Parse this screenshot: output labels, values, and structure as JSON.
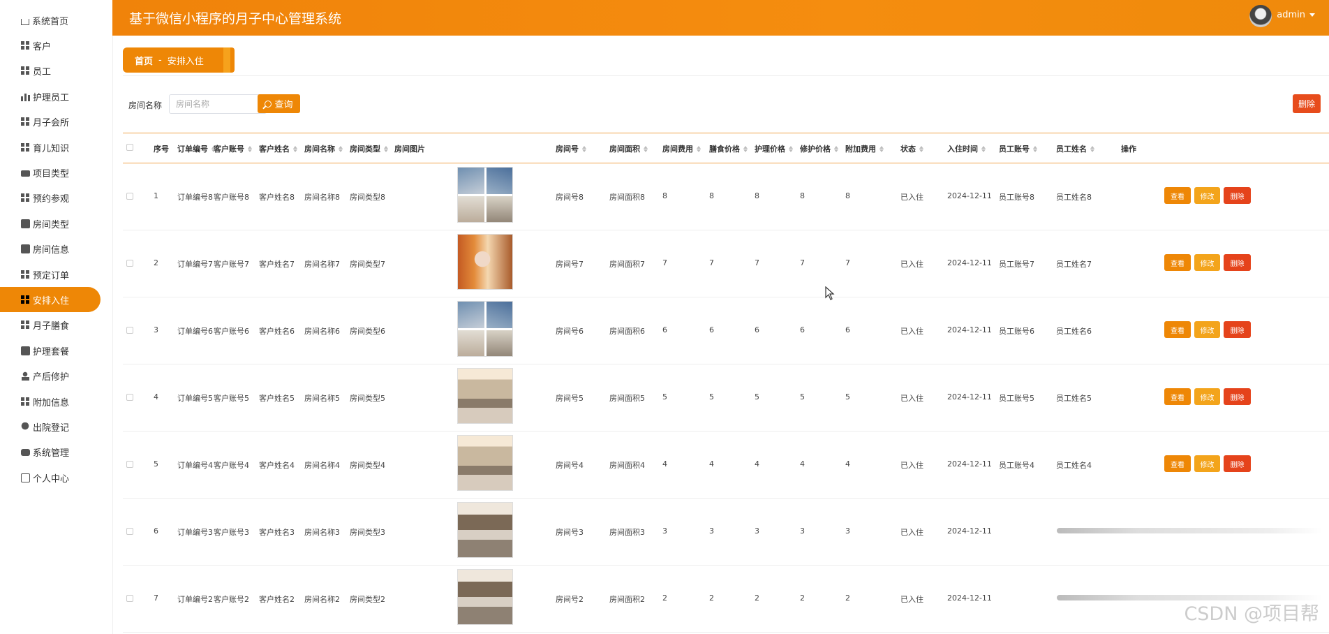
{
  "app": {
    "title": "基于微信小程序的月子中心管理系统",
    "user": "admin"
  },
  "sidebar": {
    "items": [
      {
        "label": "系统首页",
        "icon": "home-icon"
      },
      {
        "label": "客户",
        "icon": "grid-icon"
      },
      {
        "label": "员工",
        "icon": "grid-icon"
      },
      {
        "label": "护理员工",
        "icon": "bar-chart-icon"
      },
      {
        "label": "月子会所",
        "icon": "grid-icon"
      },
      {
        "label": "育儿知识",
        "icon": "grid-icon"
      },
      {
        "label": "项目类型",
        "icon": "message-icon"
      },
      {
        "label": "预约参观",
        "icon": "grid-icon"
      },
      {
        "label": "房间类型",
        "icon": "clipboard-icon"
      },
      {
        "label": "房间信息",
        "icon": "clipboard-icon"
      },
      {
        "label": "预定订单",
        "icon": "grid-icon"
      },
      {
        "label": "安排入住",
        "icon": "grid-icon",
        "active": true
      },
      {
        "label": "月子膳食",
        "icon": "grid-icon"
      },
      {
        "label": "护理套餐",
        "icon": "picture-icon"
      },
      {
        "label": "产后修护",
        "icon": "user-icon"
      },
      {
        "label": "附加信息",
        "icon": "grid-icon"
      },
      {
        "label": "出院登记",
        "icon": "location-icon"
      },
      {
        "label": "系统管理",
        "icon": "database-icon"
      },
      {
        "label": "个人中心",
        "icon": "box-icon"
      }
    ]
  },
  "breadcrumb": {
    "home": "首页",
    "separator": "-",
    "current": "安排入住"
  },
  "search": {
    "label": "房间名称",
    "placeholder": "房间名称",
    "query_button": "查询",
    "delete_button": "删除"
  },
  "table": {
    "columns": [
      "序号",
      "订单编号",
      "客户账号",
      "客户姓名",
      "房间名称",
      "房间类型",
      "房间图片",
      "房间号",
      "房间面积",
      "房间费用",
      "膳食价格",
      "护理价格",
      "修护价格",
      "附加费用",
      "状态",
      "入住时间",
      "员工账号",
      "员工姓名",
      "操作"
    ],
    "actions": {
      "view": "查看",
      "edit": "修改",
      "delete": "删除"
    },
    "rows": [
      {
        "no": "1",
        "order": "订单编号8",
        "account": "客户账号8",
        "name": "客户姓名8",
        "room_name": "房间名称8",
        "room_type": "房间类型8",
        "room_no": "房间号8",
        "area": "房间面积8",
        "room_fee": "8",
        "meal": "8",
        "care": "8",
        "repair": "8",
        "extra": "8",
        "status": "已入住",
        "checkin": "2024-12-11",
        "staff_account": "员工账号8",
        "staff_name": "员工姓名8",
        "image": "photo-collage-icon"
      },
      {
        "no": "2",
        "order": "订单编号7",
        "account": "客户账号7",
        "name": "客户姓名7",
        "room_name": "房间名称7",
        "room_type": "房间类型7",
        "room_no": "房间号7",
        "area": "房间面积7",
        "room_fee": "7",
        "meal": "7",
        "care": "7",
        "repair": "7",
        "extra": "7",
        "status": "已入住",
        "checkin": "2024-12-11",
        "staff_account": "员工账号7",
        "staff_name": "员工姓名7",
        "image": "mother-baby-photo-icon"
      },
      {
        "no": "3",
        "order": "订单编号6",
        "account": "客户账号6",
        "name": "客户姓名6",
        "room_name": "房间名称6",
        "room_type": "房间类型6",
        "room_no": "房间号6",
        "area": "房间面积6",
        "room_fee": "6",
        "meal": "6",
        "care": "6",
        "repair": "6",
        "extra": "6",
        "status": "已入住",
        "checkin": "2024-12-11",
        "staff_account": "员工账号6",
        "staff_name": "员工姓名6",
        "image": "photo-collage-icon"
      },
      {
        "no": "4",
        "order": "订单编号5",
        "account": "客户账号5",
        "name": "客户姓名5",
        "room_name": "房间名称5",
        "room_type": "房间类型5",
        "room_no": "房间号5",
        "area": "房间面积5",
        "room_fee": "5",
        "meal": "5",
        "care": "5",
        "repair": "5",
        "extra": "5",
        "status": "已入住",
        "checkin": "2024-12-11",
        "staff_account": "员工账号5",
        "staff_name": "员工姓名5",
        "image": "living-room-photo-icon"
      },
      {
        "no": "5",
        "order": "订单编号4",
        "account": "客户账号4",
        "name": "客户姓名4",
        "room_name": "房间名称4",
        "room_type": "房间类型4",
        "room_no": "房间号4",
        "area": "房间面积4",
        "room_fee": "4",
        "meal": "4",
        "care": "4",
        "repair": "4",
        "extra": "4",
        "status": "已入住",
        "checkin": "2024-12-11",
        "staff_account": "员工账号4",
        "staff_name": "员工姓名4",
        "image": "living-room-photo-icon"
      },
      {
        "no": "6",
        "order": "订单编号3",
        "account": "客户账号3",
        "name": "客户姓名3",
        "room_name": "房间名称3",
        "room_type": "房间类型3",
        "room_no": "房间号3",
        "area": "房间面积3",
        "room_fee": "3",
        "meal": "3",
        "care": "3",
        "repair": "3",
        "extra": "3",
        "status": "已入住",
        "checkin": "2024-12-11",
        "image": "bedroom-photo-icon"
      },
      {
        "no": "7",
        "order": "订单编号2",
        "account": "客户账号2",
        "name": "客户姓名2",
        "room_name": "房间名称2",
        "room_type": "房间类型2",
        "room_no": "房间号2",
        "area": "房间面积2",
        "room_fee": "2",
        "meal": "2",
        "care": "2",
        "repair": "2",
        "extra": "2",
        "status": "已入住",
        "checkin": "2024-12-11",
        "image": "bedroom-photo-icon"
      }
    ]
  },
  "watermark": "CSDN @项目帮",
  "colors": {
    "accent": "#ee8706",
    "edit": "#f3a41b",
    "danger": "#e5431b"
  }
}
